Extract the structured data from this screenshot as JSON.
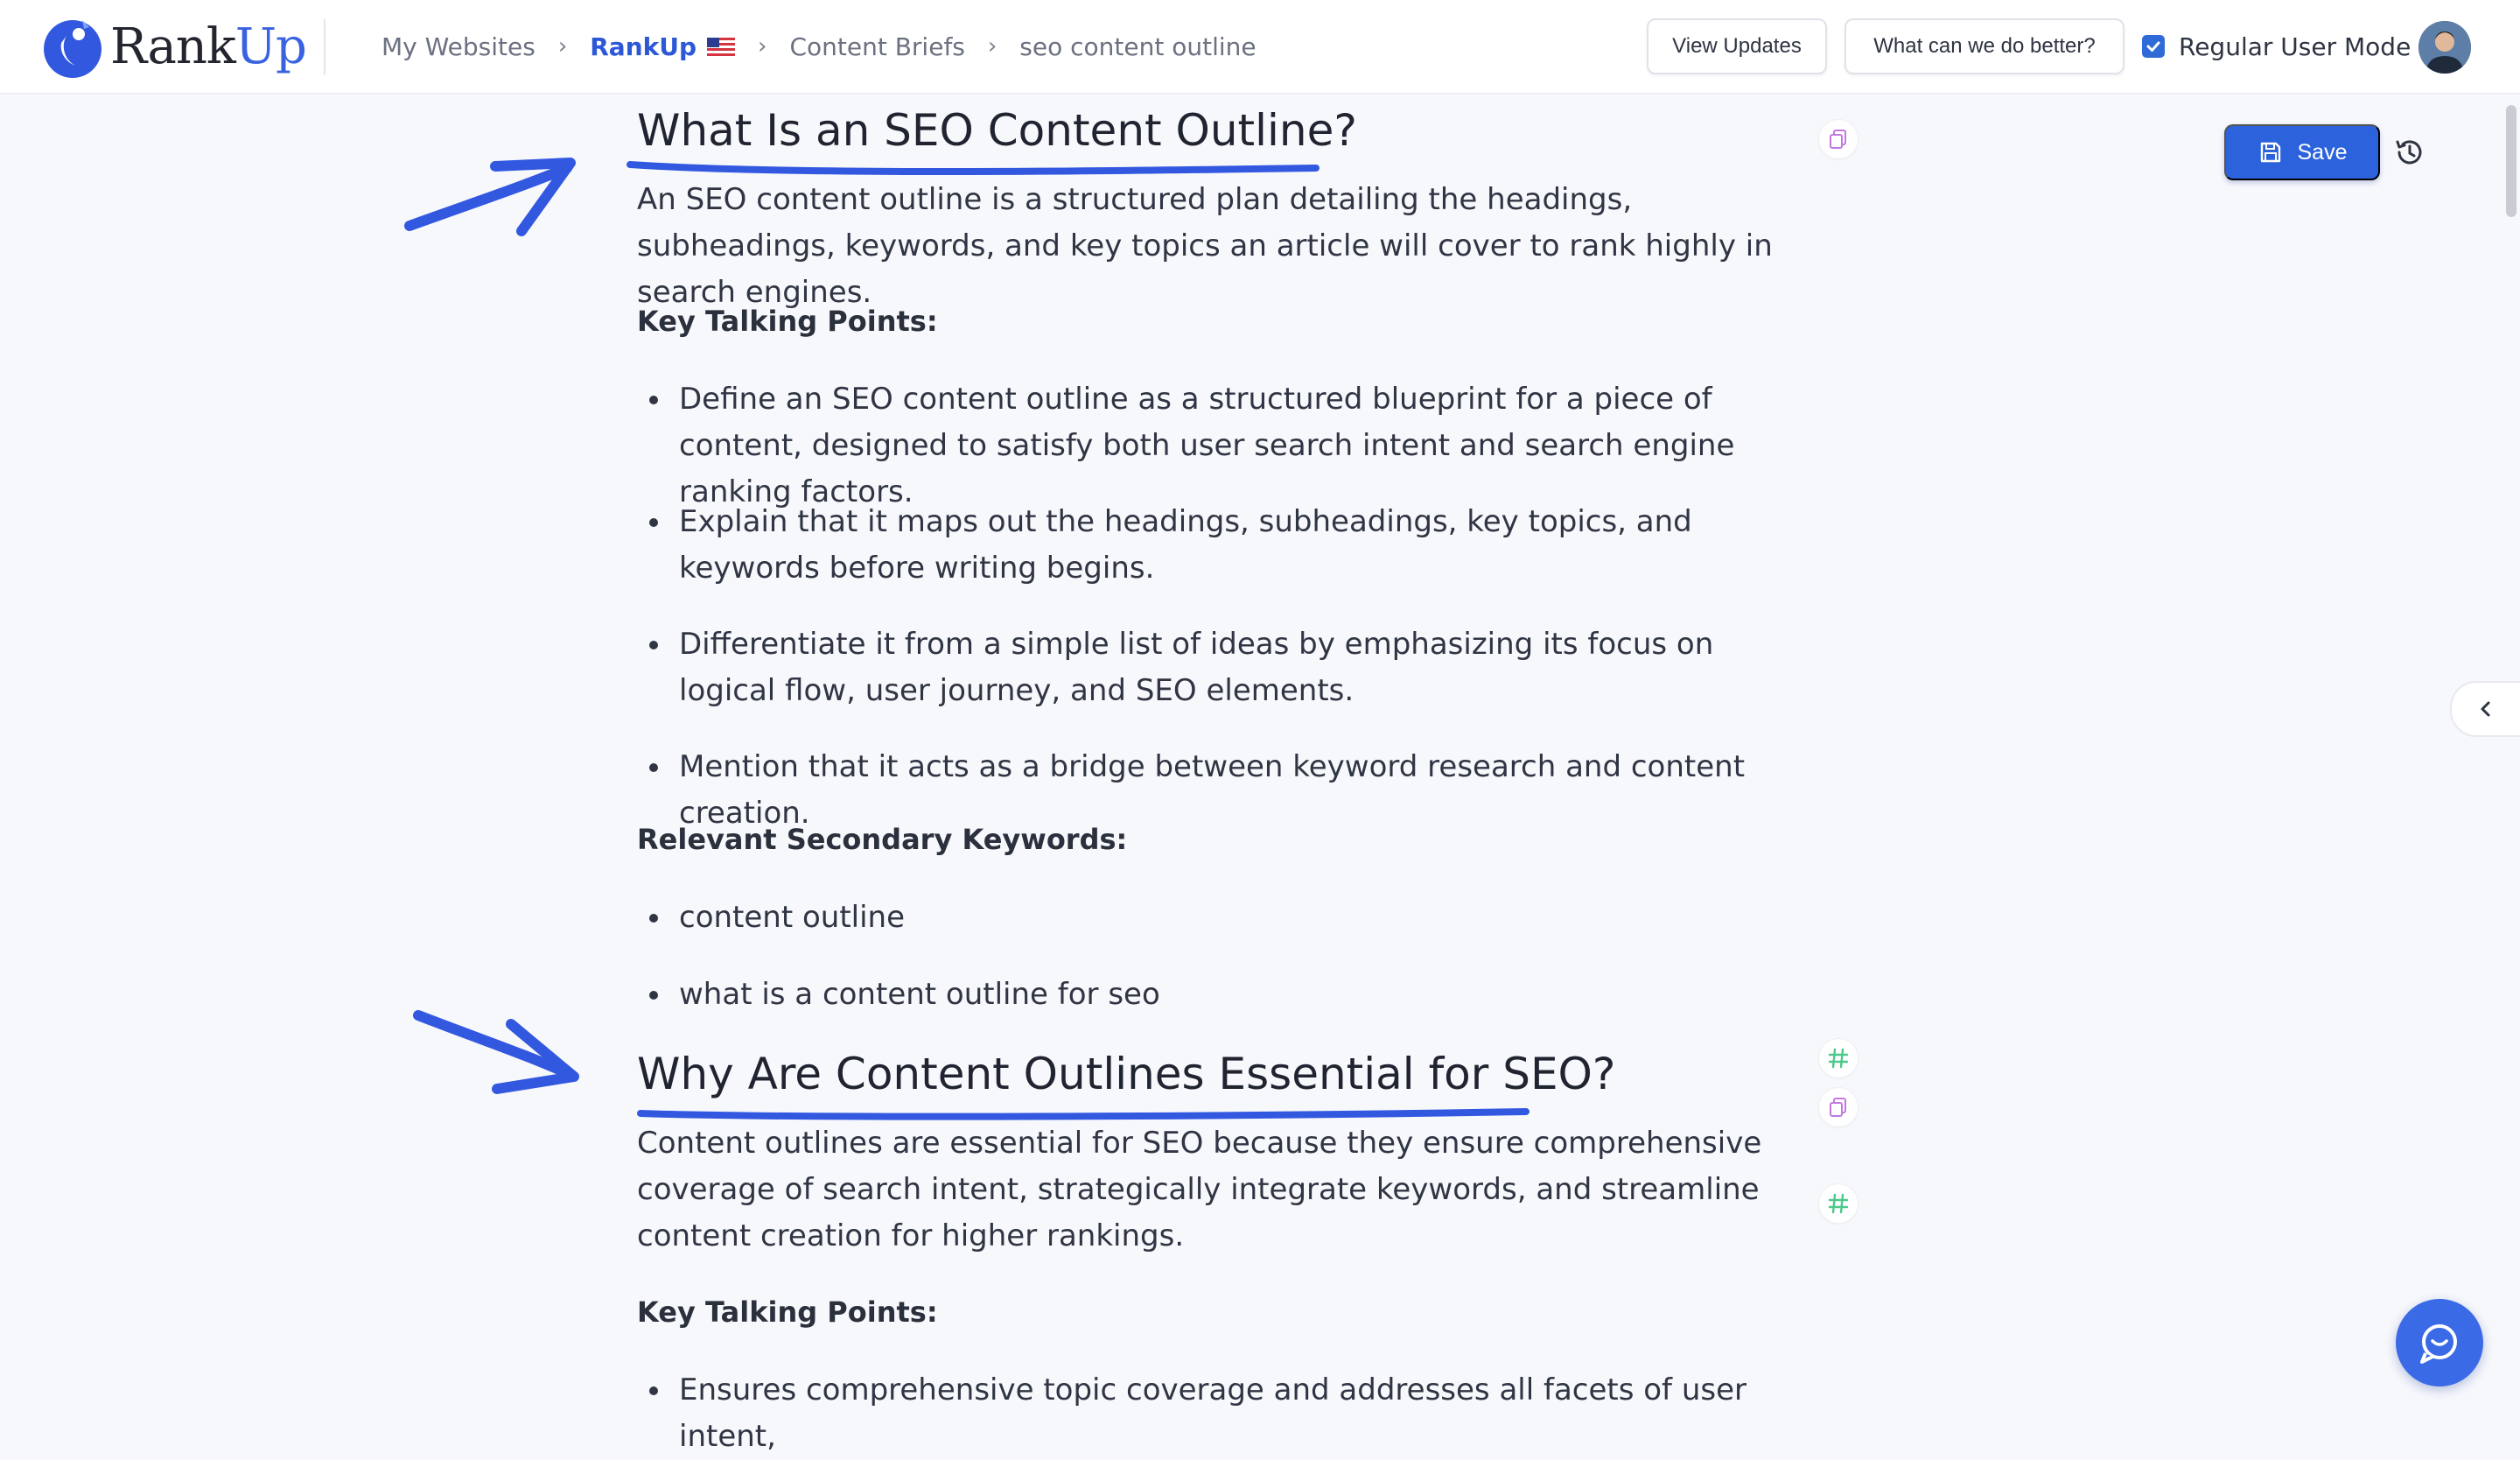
{
  "colors": {
    "accent": "#2c62dc",
    "annotation": "#3358e0",
    "hash_icon": "#4cc98a",
    "copy_icon": "#c07ae0"
  },
  "header": {
    "logo": {
      "rank": "Rank",
      "up": "Up"
    },
    "breadcrumb": [
      {
        "label": "My Websites"
      },
      {
        "label": "RankUp",
        "flag": "us-flag-icon"
      },
      {
        "label": "Content Briefs"
      },
      {
        "label": "seo content outline"
      }
    ],
    "view_updates": "View Updates",
    "feedback": "What can we do better?",
    "mode": {
      "label": "Regular User Mode",
      "checked": true
    }
  },
  "toolbar": {
    "save_label": "Save",
    "save_icon": "save-icon",
    "history_icon": "history-icon"
  },
  "sections": [
    {
      "heading": "What Is an SEO Content Outline?",
      "intro": "An SEO content outline is a structured plan detailing the headings, subheadings, keywords, and key topics an article will cover to rank highly in search engines.",
      "talking_points_label": "Key Talking Points:",
      "talking_points": [
        "Define an SEO content outline as a structured blueprint for a piece of content, designed to satisfy both user search intent and search engine ranking factors.",
        "Explain that it maps out the headings, subheadings, key topics, and keywords before writing begins.",
        "Differentiate it from a simple list of ideas by emphasizing its focus on logical flow, user journey, and SEO elements.",
        "Mention that it acts as a bridge between keyword research and content creation."
      ],
      "keywords_label": "Relevant Secondary Keywords:",
      "keywords": [
        "content outline",
        "what is a content outline for seo"
      ]
    },
    {
      "heading": "Why Are Content Outlines Essential for SEO?",
      "intro": "Content outlines are essential for SEO because they ensure comprehensive coverage of search intent, strategically integrate keywords, and streamline content creation for higher rankings.",
      "talking_points_label": "Key Talking Points:",
      "talking_points": [
        "Ensures comprehensive topic coverage and addresses all facets of user intent,"
      ]
    }
  ]
}
